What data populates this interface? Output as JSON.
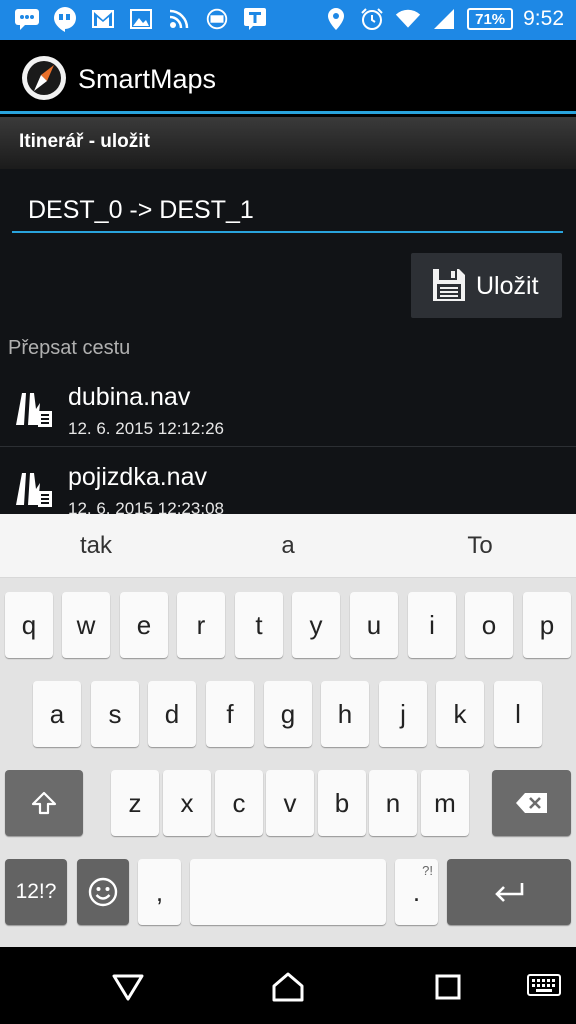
{
  "status_bar": {
    "battery": "71%",
    "time": "9:52",
    "icons": [
      "chat-icon",
      "hangouts-icon",
      "gmail-icon",
      "image-icon",
      "podcast-icon",
      "mobile-data-icon",
      "t-app-icon",
      "location-icon",
      "alarm-icon",
      "wifi-icon",
      "signal-icon",
      "battery-icon"
    ]
  },
  "app": {
    "title": "SmartMaps",
    "logo": "compass-icon"
  },
  "section": {
    "title": "Itinerář - uložit"
  },
  "route_field": {
    "value": "DEST_0 -> DEST_1"
  },
  "save_button": {
    "label": "Uložit",
    "icon": "floppy-icon"
  },
  "overwrite": {
    "label": "Přepsat cestu"
  },
  "files": [
    {
      "name": "dubina.nav",
      "date": "12. 6. 2015 12:12:26",
      "icon": "route-file-icon"
    },
    {
      "name": "pojizdka.nav",
      "date": "12. 6. 2015 12:23:08",
      "icon": "route-file-icon"
    }
  ],
  "keyboard": {
    "suggestions": [
      "tak",
      "a",
      "To"
    ],
    "row1": [
      "q",
      "w",
      "e",
      "r",
      "t",
      "y",
      "u",
      "i",
      "o",
      "p"
    ],
    "row2": [
      "a",
      "s",
      "d",
      "f",
      "g",
      "h",
      "j",
      "k",
      "l"
    ],
    "row3": [
      "z",
      "x",
      "c",
      "v",
      "b",
      "n",
      "m"
    ],
    "symbols_label": "12!?",
    "comma": ",",
    "period": ".",
    "period_hint": "?!",
    "accent_dark": "#666666"
  },
  "nav": {
    "icons": [
      "back-icon",
      "home-icon",
      "recents-icon",
      "keyboard-icon"
    ]
  }
}
